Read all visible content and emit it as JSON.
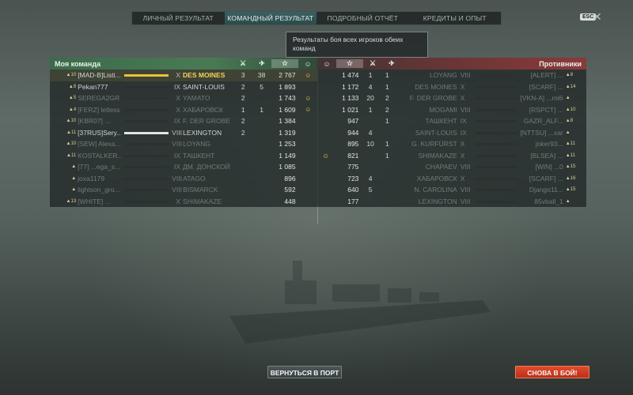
{
  "tabs": [
    "ЛИЧНЫЙ РЕЗУЛЬТАТ",
    "КОМАНДНЫЙ РЕЗУЛЬТАТ",
    "ПОДРОБНЫЙ ОТЧЁТ",
    "КРЕДИТЫ И ОПЫТ"
  ],
  "active_tab": 1,
  "esc_label": "ESC",
  "tooltip": "Результаты боя всех игроков обеих команд",
  "left_header": "Моя команда",
  "right_header": "Противники",
  "left_rows": [
    {
      "rank": "10",
      "player": "[MAD-B]Listi...",
      "tier": "X",
      "ship": "DES MOINES",
      "kills": "3",
      "planes": "38",
      "exp": "2 767",
      "medal": "☺",
      "hl": true,
      "gold": true
    },
    {
      "rank": "8",
      "player": "Pekan777",
      "tier": "IX",
      "ship": "SAINT-LOUIS",
      "kills": "2",
      "planes": "5",
      "exp": "1 893",
      "medal": ""
    },
    {
      "rank": "5",
      "player": "SEREGA2GR",
      "tier": "X",
      "ship": "YAMATO",
      "kills": "2",
      "planes": "",
      "exp": "1 743",
      "medal": "☺",
      "dead": true
    },
    {
      "rank": "4",
      "player": "[FERZ] letless",
      "tier": "X",
      "ship": "ХАБАРОВСК",
      "kills": "1",
      "planes": "1",
      "exp": "1 609",
      "medal": "☺",
      "dead": true
    },
    {
      "rank": "10",
      "player": "[KBR07] ...",
      "tier": "IX",
      "ship": "F. DER GROBE",
      "kills": "2",
      "planes": "",
      "exp": "1 384",
      "medal": "",
      "dead": true
    },
    {
      "rank": "11",
      "player": "[37RUS]Sery...",
      "tier": "VIII",
      "ship": "LEXINGTON",
      "kills": "2",
      "planes": "",
      "exp": "1 319",
      "medal": "",
      "light": true
    },
    {
      "rank": "10",
      "player": "[SEW] Alexa...",
      "tier": "VIII",
      "ship": "LOYANG",
      "kills": "",
      "planes": "",
      "exp": "1 253",
      "medal": "",
      "dead": true
    },
    {
      "rank": "11",
      "player": "KOSTALKER...",
      "tier": "IX",
      "ship": "ТАШКЕНТ",
      "kills": "",
      "planes": "",
      "exp": "1 149",
      "medal": "",
      "dead": true
    },
    {
      "rank": "",
      "player": "[77] ...ega_s...",
      "tier": "IX",
      "ship": "ДМ. ДОНСКОЙ",
      "kills": "",
      "planes": "",
      "exp": "1 085",
      "medal": "",
      "dead": true
    },
    {
      "rank": "",
      "player": "joxa1179",
      "tier": "VIII",
      "ship": "ATAGO",
      "kills": "",
      "planes": "",
      "exp": "896",
      "medal": "",
      "dead": true
    },
    {
      "rank": "",
      "player": "lightson_gro...",
      "tier": "VIII",
      "ship": "BISMARCK",
      "kills": "",
      "planes": "",
      "exp": "592",
      "medal": "",
      "dead": true
    },
    {
      "rank": "13",
      "player": "[WHITE] ...",
      "tier": "X",
      "ship": "SHIMAKAZE",
      "kills": "",
      "planes": "",
      "exp": "448",
      "medal": "",
      "dead": true
    }
  ],
  "right_rows": [
    {
      "medal": "",
      "exp": "1 474",
      "kills": "1",
      "planes": "1",
      "ship": "LOYANG",
      "tier": "VIII",
      "player": "[ALERT] ...",
      "rank": "8",
      "dead": true
    },
    {
      "medal": "",
      "exp": "1 172",
      "kills": "4",
      "planes": "1",
      "ship": "DES MOINES",
      "tier": "X",
      "player": "[SCARF] ...",
      "rank": "14",
      "dead": true
    },
    {
      "medal": "",
      "exp": "1 133",
      "kills": "20",
      "planes": "2",
      "ship": "F. DER GROBE",
      "tier": "X",
      "player": "[VKN-A] ...mi6666",
      "rank": "",
      "dead": true
    },
    {
      "medal": "",
      "exp": "1 021",
      "kills": "1",
      "planes": "2",
      "ship": "MOGAMI",
      "tier": "VIII",
      "player": "[RSPCT] ...",
      "rank": "10",
      "dead": true
    },
    {
      "medal": "",
      "exp": "947",
      "kills": "",
      "planes": "1",
      "ship": "ТАШКЕНТ",
      "tier": "IX",
      "player": "GAZR_ALF...",
      "rank": "8",
      "dead": true
    },
    {
      "medal": "",
      "exp": "944",
      "kills": "4",
      "planes": "",
      "ship": "SAINT-LOUIS",
      "tier": "IX",
      "player": "[NTTSU] ...xander974",
      "rank": "",
      "dead": true
    },
    {
      "medal": "",
      "exp": "895",
      "kills": "10",
      "planes": "1",
      "ship": "G. KURFÜRST",
      "tier": "X",
      "player": "joker93...",
      "rank": "11",
      "dead": true
    },
    {
      "medal": "☺",
      "exp": "821",
      "kills": "",
      "planes": "1",
      "ship": "SHIMAKAZE",
      "tier": "X",
      "player": "[BLSEA] ...",
      "rank": "11",
      "dead": true
    },
    {
      "medal": "",
      "exp": "775",
      "kills": "",
      "planes": "",
      "ship": "CHAPAEV",
      "tier": "VIII",
      "player": "[WIN] ...0",
      "rank": "15",
      "dead": true
    },
    {
      "medal": "",
      "exp": "723",
      "kills": "4",
      "planes": "",
      "ship": "ХАБАРОВСК",
      "tier": "X",
      "player": "[SCARF] ...",
      "rank": "16",
      "dead": true
    },
    {
      "medal": "",
      "exp": "640",
      "kills": "5",
      "planes": "",
      "ship": "N. CAROLINA",
      "tier": "VIII",
      "player": "Django11...",
      "rank": "15",
      "dead": true
    },
    {
      "medal": "",
      "exp": "177",
      "kills": "",
      "planes": "",
      "ship": "LEXINGTON",
      "tier": "VIII",
      "player": "85vball_1",
      "rank": "",
      "dead": true
    }
  ],
  "buttons": {
    "port": "ВЕРНУТЬСЯ В ПОРТ",
    "battle": "СНОВА В БОЙ!"
  }
}
